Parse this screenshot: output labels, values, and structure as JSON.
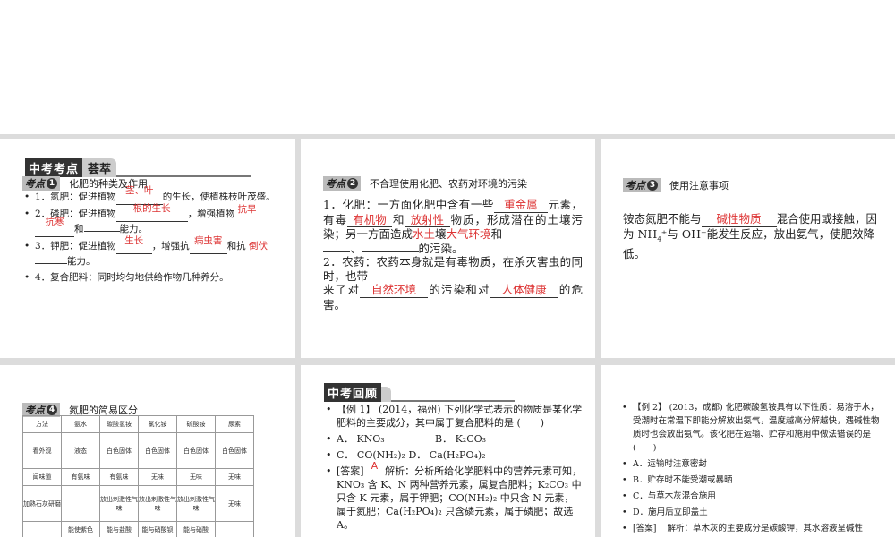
{
  "slide1": {
    "banner_dark": "中考考点",
    "banner_light": "荟萃",
    "kaodian_label": "考点",
    "kaodian_num": "1",
    "title": "化肥的种类及作用",
    "items": [
      {
        "pre": "1．氮肥：促进植物",
        "answer": "茎、叶",
        "post": "的生长，使植株枝叶茂盛。"
      },
      {
        "pre": "2．磷肥：促进植物",
        "answer1": "根的生长",
        "mid": "，增强植物",
        "answer2": "抗旱",
        "answer3": "抗寒",
        "and": "和",
        "post": "能力。"
      },
      {
        "pre": "3．钾肥：促进植物",
        "answer1": "生长",
        "mid": "，增强抗",
        "answer2": "病虫害",
        "and": "和抗",
        "answer3": "倒伏",
        "post": "能力。"
      },
      {
        "text": "4．复合肥料：同时均匀地供给作物几种养分。"
      }
    ]
  },
  "slide2": {
    "kaodian_label": "考点",
    "kaodian_num": "2",
    "title": "不合理使用化肥、农药对环境的污染",
    "p1_a": "1．化肥：一方面化肥中含有一些",
    "ans_heavy": "重金属",
    "p1_b": "元素，有毒",
    "ans_organic": "有机物",
    "p1_c": "和",
    "ans_radio": "放射性",
    "p1_d": "物质，形成潜在的土壤污染；另一方面造成",
    "ans_water": "水土",
    "p1_e": "壤",
    "ans_air": "大气环境",
    "p1_f": "和",
    "p1_g": "、",
    "p1_h": "的污染。",
    "p2_a": "2．农药：农药本身就是有毒物质，在杀灭害虫的同时，也带",
    "p2_b": "来了对",
    "ans_nature": "自然环境",
    "p2_c": "的污染和对",
    "ans_health": "人体健康",
    "p2_d": "的危害。"
  },
  "slide3": {
    "kaodian_label": "考点",
    "kaodian_num": "3",
    "title": "使用注意事项",
    "t1": "铵态氮肥不能与",
    "answer": "碱性物质",
    "t2": "混合使用或接触，因为 NH",
    "sub": "4",
    "t3": "⁺与 OH⁻能发生反应，放出氨气，使肥效降低。"
  },
  "slide4": {
    "kaodian_label": "考点",
    "kaodian_num": "4",
    "title": "氮肥的简易区分",
    "table": [
      [
        "方法",
        "氨水",
        "碳酸氢铵",
        "氯化铵",
        "硫酸铵",
        "尿素"
      ],
      [
        "看外观",
        "液态",
        "白色固体",
        "白色固体",
        "白色固体",
        "白色固体"
      ],
      [
        "闻味道",
        "有氨味",
        "有氨味",
        "无味",
        "无味",
        "无味"
      ],
      [
        "加熟石灰研磨",
        "",
        "放出刺激性气味",
        "放出刺激性气味",
        "放出刺激性气味",
        "无味"
      ],
      [
        "",
        "能使紫色",
        "能与盐酸",
        "能与硝酸钡",
        "能与硝酸",
        ""
      ]
    ]
  },
  "slide5": {
    "banner_dark": "中考回顾",
    "ex": "【例 1】 (2014，福州) 下列化学式表示的物质是某化学肥料的主要成分，其中属于复合肥料的是 (　　)",
    "options": [
      "A． KNO₃",
      "B． K₂CO₃",
      "C． CO(NH₂)₂",
      "D． Ca(H₂PO₄)₂"
    ],
    "answer": "A",
    "answer_label": "[答案]",
    "analysis": "解析：分析所给化学肥料中的营养元素可知，KNO₃ 含 K、N 两种营养元素，属复合肥料；K₂CO₃ 中只含 K 元素，属于钾肥；CO(NH₂)₂ 中只含 N 元素，属于氮肥；Ca(H₂PO₄)₂ 只含磷元素，属于磷肥；故选 A。"
  },
  "slide6": {
    "ex": "【例 2】 (2013，成都) 化肥碳酸氢铵具有以下性质：易溶于水，受潮时在常温下即能分解放出氨气，温度越高分解越快，遇碱性物质时也会放出氨气。该化肥在运输、贮存和施用中做法错误的是 (　　)",
    "options": [
      "A．运输时注意密封",
      "B．贮存时不能受潮或暴晒",
      "C．与草木灰混合施用",
      "D．施用后立即盖土"
    ],
    "answer_label": "[答案]",
    "analysis": "解析：草木灰的主要成分是碳酸钾，其水溶液呈碱性"
  }
}
